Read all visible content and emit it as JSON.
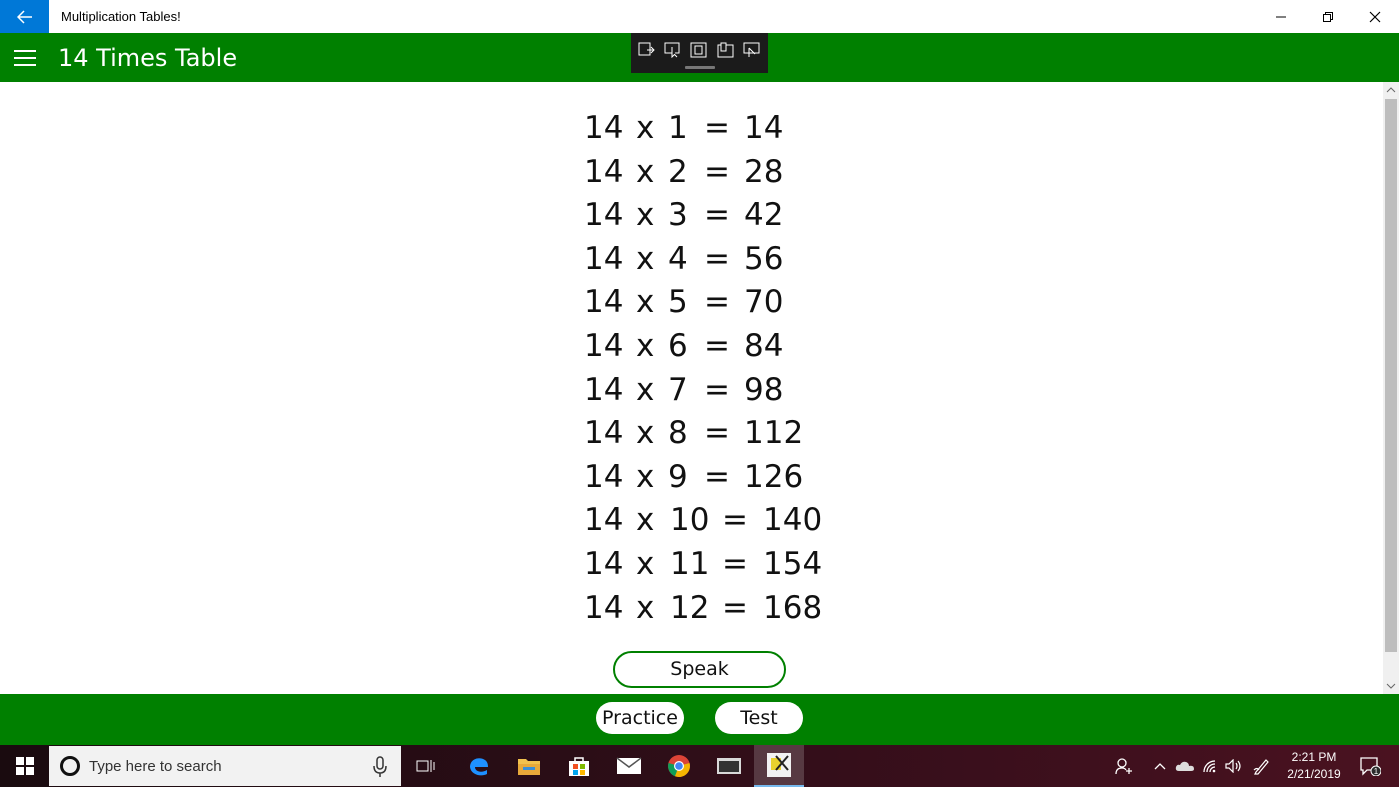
{
  "window": {
    "title": "Multiplication Tables!"
  },
  "header": {
    "page_title": "14 Times Table"
  },
  "table": {
    "rows": [
      {
        "a": "14",
        "op": "x",
        "b": "1",
        "eq": "=",
        "result": "14"
      },
      {
        "a": "14",
        "op": "x",
        "b": "2",
        "eq": "=",
        "result": "28"
      },
      {
        "a": "14",
        "op": "x",
        "b": "3",
        "eq": "=",
        "result": "42"
      },
      {
        "a": "14",
        "op": "x",
        "b": "4",
        "eq": "=",
        "result": "56"
      },
      {
        "a": "14",
        "op": "x",
        "b": "5",
        "eq": "=",
        "result": "70"
      },
      {
        "a": "14",
        "op": "x",
        "b": "6",
        "eq": "=",
        "result": "84"
      },
      {
        "a": "14",
        "op": "x",
        "b": "7",
        "eq": "=",
        "result": "98"
      },
      {
        "a": "14",
        "op": "x",
        "b": "8",
        "eq": "=",
        "result": "112"
      },
      {
        "a": "14",
        "op": "x",
        "b": "9",
        "eq": "=",
        "result": "126"
      },
      {
        "a": "14",
        "op": "x",
        "b": "10",
        "eq": "=",
        "result": "140"
      },
      {
        "a": "14",
        "op": "x",
        "b": "11",
        "eq": "=",
        "result": "154"
      },
      {
        "a": "14",
        "op": "x",
        "b": "12",
        "eq": "=",
        "result": "168"
      }
    ]
  },
  "actions": {
    "speak_label": "Speak",
    "practice_label": "Practice",
    "test_label": "Test"
  },
  "taskbar": {
    "search_placeholder": "Type here to search",
    "time": "2:21 PM",
    "date": "2/21/2019",
    "notification_count": "1"
  },
  "colors": {
    "accent_green": "#008000",
    "back_blue": "#0078d7"
  },
  "icons": {
    "back": "back-arrow-icon",
    "menu": "hamburger-menu-icon",
    "minimize": "minimize-icon",
    "maximize": "restore-icon",
    "close": "close-icon"
  }
}
